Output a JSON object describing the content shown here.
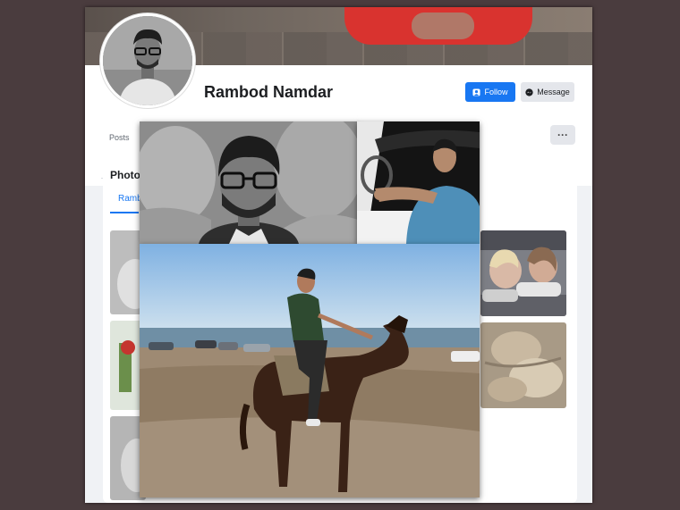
{
  "profile": {
    "name": "Rambod Namdar",
    "follow_label": "Follow",
    "message_label": "Message"
  },
  "nav": {
    "posts_label": "Posts",
    "more_label": "···"
  },
  "photos": {
    "title": "Photo",
    "tab_label": "Ramb"
  },
  "icons": [
    "follow-icon",
    "messenger-icon",
    "more-dots-icon"
  ],
  "colors": {
    "accent": "#1877f2",
    "background": "#4a3c3e"
  }
}
